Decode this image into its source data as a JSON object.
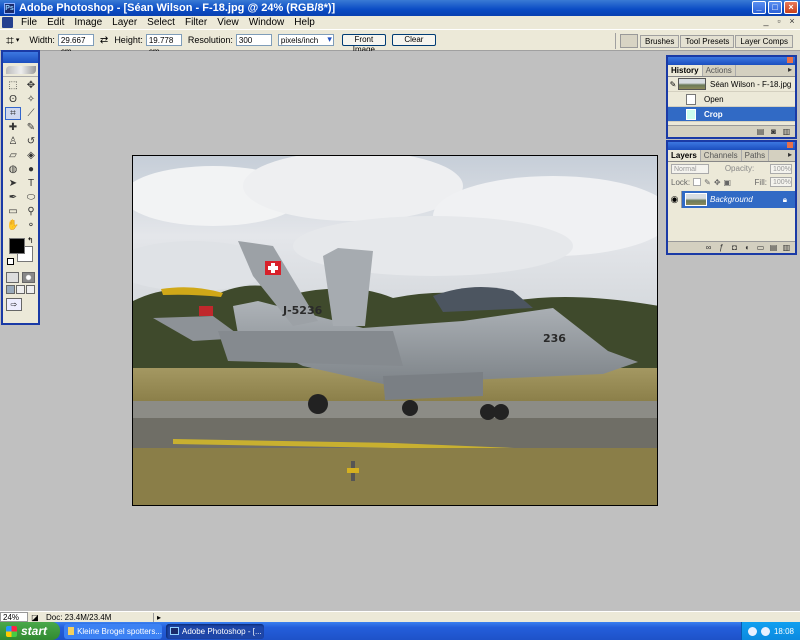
{
  "window": {
    "title": "Adobe Photoshop - [Séan Wilson - F-18.jpg @ 24% (RGB/8*)]",
    "buttons": {
      "minimize": "_",
      "maximize": "□",
      "close": "×"
    }
  },
  "menu": {
    "items": [
      "File",
      "Edit",
      "Image",
      "Layer",
      "Select",
      "Filter",
      "View",
      "Window",
      "Help"
    ],
    "doc_buttons": {
      "minimize": "_",
      "restore": "▫",
      "close": "×"
    }
  },
  "options_bar": {
    "width_label": "Width:",
    "width_value": "29.667 cm",
    "height_label": "Height:",
    "height_value": "19.778 cm",
    "resolution_label": "Resolution:",
    "resolution_value": "300",
    "resolution_unit": "pixels/inch",
    "front_image_button": "Front Image",
    "clear_button": "Clear",
    "well_tabs": [
      "Brushes",
      "Tool Presets",
      "Layer Comps"
    ]
  },
  "tools": [
    {
      "icon": "marquee-icon",
      "glyph": "⬚"
    },
    {
      "icon": "move-icon",
      "glyph": "✥"
    },
    {
      "icon": "lasso-icon",
      "glyph": "ʘ"
    },
    {
      "icon": "magic-wand-icon",
      "glyph": "✧"
    },
    {
      "icon": "crop-icon",
      "glyph": "⌗",
      "selected": true
    },
    {
      "icon": "slice-icon",
      "glyph": "⟋"
    },
    {
      "icon": "healing-brush-icon",
      "glyph": "✚"
    },
    {
      "icon": "brush-icon",
      "glyph": "✎"
    },
    {
      "icon": "clone-stamp-icon",
      "glyph": "♙"
    },
    {
      "icon": "history-brush-icon",
      "glyph": "↺"
    },
    {
      "icon": "eraser-icon",
      "glyph": "▱"
    },
    {
      "icon": "paint-bucket-icon",
      "glyph": "◈"
    },
    {
      "icon": "blur-icon",
      "glyph": "◍"
    },
    {
      "icon": "dodge-icon",
      "glyph": "●"
    },
    {
      "icon": "path-select-icon",
      "glyph": "➤"
    },
    {
      "icon": "type-icon",
      "glyph": "T"
    },
    {
      "icon": "pen-icon",
      "glyph": "✒"
    },
    {
      "icon": "shape-icon",
      "glyph": "⬭"
    },
    {
      "icon": "notes-icon",
      "glyph": "▭"
    },
    {
      "icon": "eyedropper-icon",
      "glyph": "⚲"
    },
    {
      "icon": "hand-icon",
      "glyph": "✋"
    },
    {
      "icon": "zoom-icon",
      "glyph": "⚬"
    }
  ],
  "history_panel": {
    "tabs": [
      "History",
      "Actions"
    ],
    "snapshot_label": "Séan Wilson - F-18.jpg",
    "states": [
      {
        "label": "Open",
        "selected": false
      },
      {
        "label": "Crop",
        "selected": true
      }
    ]
  },
  "layers_panel": {
    "tabs": [
      "Layers",
      "Channels",
      "Paths"
    ],
    "blend_mode": "Normal",
    "opacity_label": "Opacity:",
    "opacity_value": "100%",
    "lock_label": "Lock:",
    "fill_label": "Fill:",
    "fill_value": "100%",
    "layer_name": "Background"
  },
  "aircraft": {
    "tail_code": "J-5236",
    "nose_number": "236"
  },
  "status_bar": {
    "zoom": "24%",
    "doc_size": "Doc: 23.4M/23.4M"
  },
  "taskbar": {
    "start_label": "start",
    "tasks": [
      "Kleine Brogel spotters...",
      "Adobe Photoshop - [..."
    ],
    "clock": "18:08"
  },
  "colors": {
    "foreground": "#000000",
    "background": "#ffffff",
    "selection_blue": "#316ac5",
    "panel_border": "#1a3aa6"
  }
}
